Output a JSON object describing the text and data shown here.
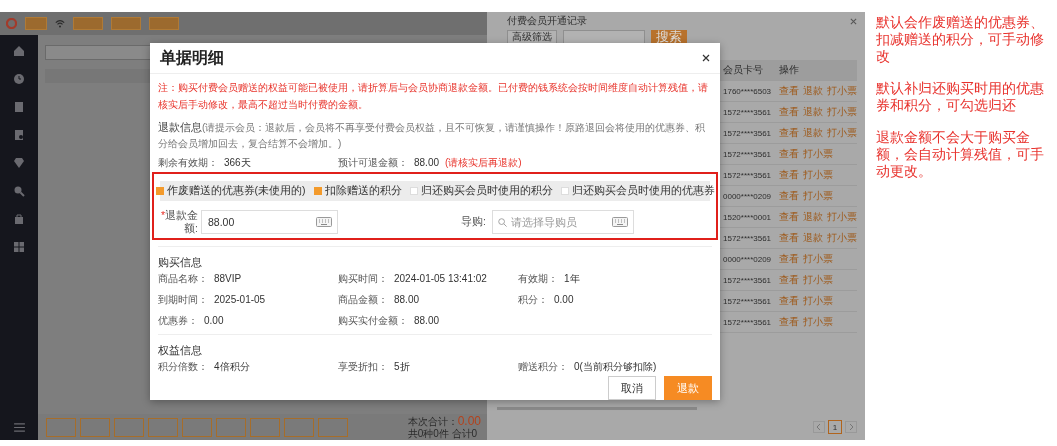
{
  "records_panel": {
    "title": "付费会员开通记录",
    "filter_button": "高级筛选",
    "search_button": "搜索",
    "columns": [
      "会员卡号",
      "操作"
    ],
    "rows": [
      {
        "card": "1760****6503",
        "actions": [
          "查看",
          "退款",
          "打小票"
        ]
      },
      {
        "card": "1572****3561",
        "actions": [
          "查看",
          "退款",
          "打小票"
        ]
      },
      {
        "card": "1572****3561",
        "actions": [
          "查看",
          "退款",
          "打小票"
        ]
      },
      {
        "card": "1572****3561",
        "actions": [
          "查看",
          "打小票"
        ]
      },
      {
        "card": "1572****3561",
        "actions": [
          "查看",
          "打小票"
        ]
      },
      {
        "card": "0000****0209",
        "actions": [
          "查看",
          "打小票"
        ]
      },
      {
        "card": "1520****0001",
        "actions": [
          "查看",
          "退款",
          "打小票"
        ]
      },
      {
        "card": "1572****3561",
        "actions": [
          "查看",
          "退款",
          "打小票"
        ]
      },
      {
        "card": "0000****0209",
        "actions": [
          "查看",
          "打小票"
        ]
      },
      {
        "card": "1572****3561",
        "actions": [
          "查看",
          "打小票"
        ]
      },
      {
        "card": "1572****3561",
        "actions": [
          "查看",
          "打小票"
        ]
      },
      {
        "card": "1572****3561",
        "actions": [
          "查看",
          "打小票"
        ]
      }
    ],
    "page": "1"
  },
  "cart_summary": {
    "total_label": "本次合计：",
    "total": "0.00",
    "count": "共0种0件 合计0"
  },
  "dialog": {
    "title": "单据明细",
    "notice": "注：购买付费会员赠送的权益可能已被使用，请折算后与会员协商退款金额。已付费的钱系统会按时间维度自动计算残值，请核实后手动修改，最高不超过当时付费的金额。",
    "refund": {
      "heading": "退款信息",
      "hint": "(请提示会员：退款后，会员将不再享受付费会员权益，且不可恢复，请谨慎操作！原路退回会将使用的优惠券、积分给会员增加回去，复合结算不会增加。)",
      "remaining": {
        "label": "剩余有效期：",
        "value": "366天"
      },
      "estimate": {
        "label": "预计可退金额：",
        "value": "88.00",
        "note": "(请核实后再退款)"
      },
      "options": [
        {
          "label": "作废赠送的优惠券(未使用的)",
          "checked": true
        },
        {
          "label": "扣除赠送的积分",
          "checked": true
        },
        {
          "label": "归还购买会员时使用的积分",
          "checked": false
        },
        {
          "label": "归还购买会员时使用的优惠券",
          "checked": false
        }
      ],
      "amount": {
        "required_mark": "*",
        "label": "退款金额:",
        "value": "88.00"
      },
      "guide": {
        "label": "导购:",
        "placeholder": "请选择导购员"
      }
    },
    "purchase": {
      "heading": "购买信息",
      "fields": [
        {
          "label": "商品名称：",
          "value": "88VIP"
        },
        {
          "label": "购买时间：",
          "value": "2024-01-05 13:41:02"
        },
        {
          "label": "有效期：",
          "value": "1年"
        },
        {
          "label": "到期时间：",
          "value": "2025-01-05"
        },
        {
          "label": "商品金额：",
          "value": "88.00"
        },
        {
          "label": "积分：",
          "value": "0.00"
        },
        {
          "label": "优惠券：",
          "value": "0.00"
        },
        {
          "label": "购买实付金额：",
          "value": "88.00"
        }
      ]
    },
    "benefits": {
      "heading": "权益信息",
      "fields": [
        {
          "label": "积分倍数：",
          "value": "4倍积分"
        },
        {
          "label": "享受折扣：",
          "value": "5折"
        },
        {
          "label": "赠送积分：",
          "value": "0(当前积分够扣除)"
        }
      ]
    },
    "buttons": [
      {
        "label": "取消",
        "kind": "secondary"
      },
      {
        "label": "退款",
        "kind": "primary"
      }
    ]
  },
  "annotations": [
    "默认会作废赠送的优惠券、扣减赠送的积分，可手动修改",
    "默认补归还购买时用的优惠券和积分，可勾选归还",
    "退款金额不会大于购买金额，会自动计算残值，可手动更改。"
  ]
}
